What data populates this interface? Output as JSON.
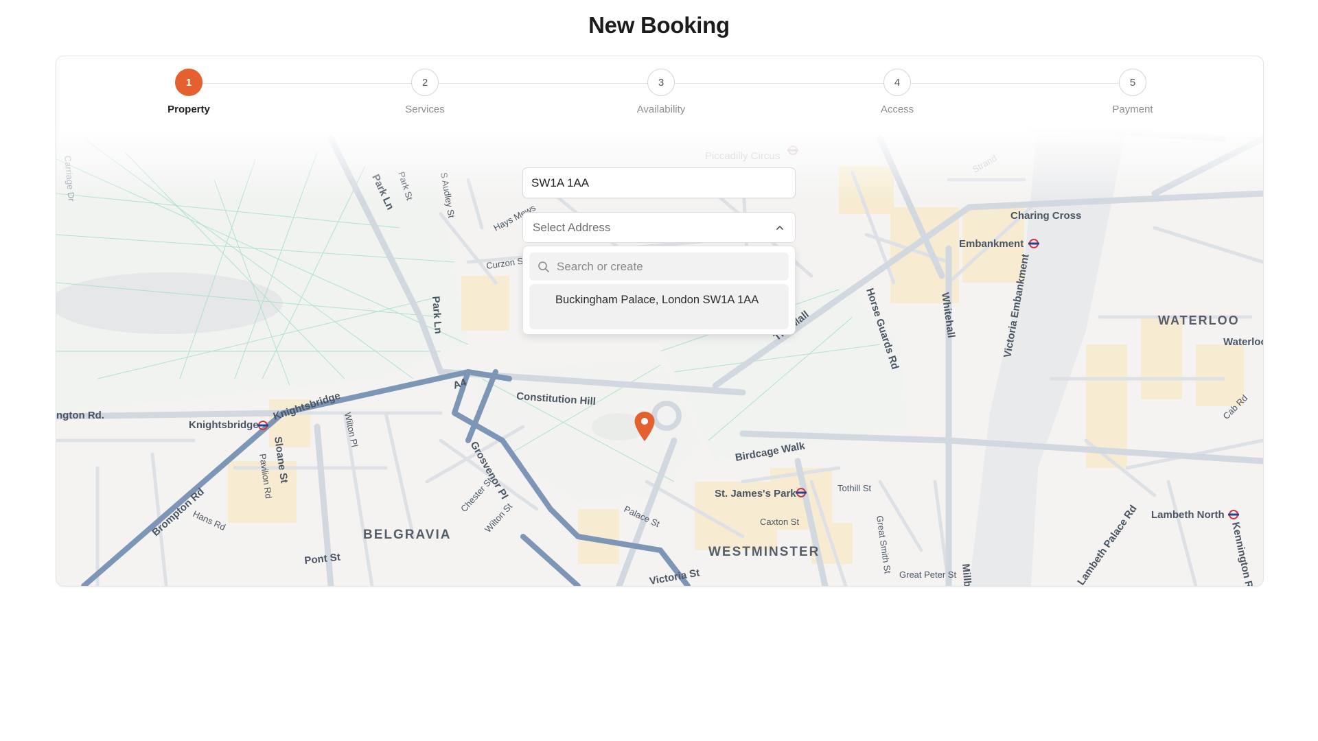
{
  "page": {
    "title": "New Booking"
  },
  "stepper": {
    "steps": [
      {
        "number": "1",
        "label": "Property",
        "active": true
      },
      {
        "number": "2",
        "label": "Services",
        "active": false
      },
      {
        "number": "3",
        "label": "Availability",
        "active": false
      },
      {
        "number": "4",
        "label": "Access",
        "active": false
      },
      {
        "number": "5",
        "label": "Payment",
        "active": false
      }
    ]
  },
  "form": {
    "postcode_value": "SW1A 1AA",
    "address_select_placeholder": "Select Address",
    "dropdown": {
      "search_placeholder": "Search or create",
      "options": [
        "Buckingham Palace, London SW1A 1AA"
      ]
    }
  },
  "map": {
    "labels": {
      "piccadilly_circus": "Piccadilly Circus",
      "charing_cross": "Charing Cross",
      "embankment": "Embankment",
      "waterloo": "WATERLOO",
      "waterloo_station": "Waterloo",
      "victoria_embankment": "Victoria Embankment",
      "horse_guards_rd": "Horse Guards Rd",
      "whitehall": "Whitehall",
      "the_mall": "The Mall",
      "park_ln": "Park Ln",
      "park_ln_2": "Park Ln",
      "park_st": "Park St",
      "s_audley_st": "S Audley St",
      "hays_mews": "Hays Mews",
      "curzon_st": "Curzon St",
      "a4": "A4",
      "constitution_hill": "Constitution Hill",
      "birdcage_walk": "Birdcage Walk",
      "knightsbridge_station": "Knightsbridge",
      "knightsbridge_road": "Knightsbridge",
      "brompton_road": "Brompton Rd",
      "hans_rd": "Hans Rd",
      "sloane_st": "Sloane St",
      "pavilion_rd": "Pavilion Rd",
      "wilton_pl": "Wilton Pl",
      "belgravia": "BELGRAVIA",
      "grosvenor_pl": "Grosvenor Pl",
      "chester_st": "Chester St",
      "wilton_st": "Wilton St",
      "pont_st": "Pont St",
      "st_jamess_park": "St. James's Park",
      "tothill_st": "Tothill St",
      "palace_st": "Palace St",
      "caxton_st": "Caxton St",
      "westminster": "WESTMINSTER",
      "great_smith_st": "Great Smith St",
      "great_peter_st": "Great Peter St",
      "victoria_st": "Victoria St",
      "lambeth_north": "Lambeth North",
      "lambeth_palace_rd": "Lambeth Palace Rd",
      "kennington_rd": "Kennington Rd",
      "cab_rd": "Cab Rd",
      "carriage_dr": "Carriage Dr",
      "brompton_rd_left": "ngton Rd.",
      "strand": "Strand",
      "millbank": "Millb"
    }
  },
  "colors": {
    "accent": "#e5602f",
    "major_road": "#7e96b6",
    "park_line": "#a9dfc8",
    "block": "#f7ecd1",
    "river": "#e9eaec"
  }
}
